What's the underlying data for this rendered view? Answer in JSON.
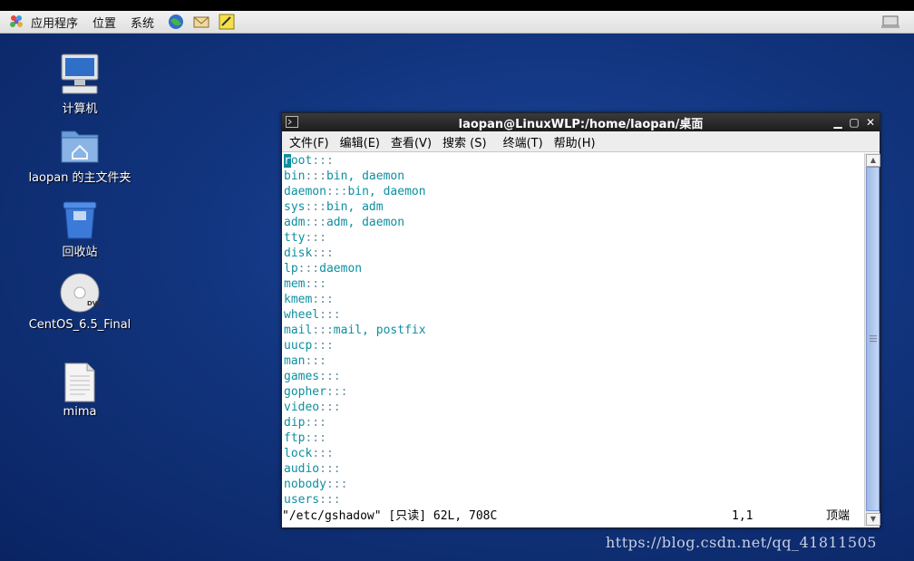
{
  "panel": {
    "menu": [
      "应用程序",
      "位置",
      "系统"
    ]
  },
  "desktop": {
    "icons": [
      {
        "label": "计算机"
      },
      {
        "label": "laopan 的主文件夹"
      },
      {
        "label": "回收站"
      },
      {
        "label": "CentOS_6.5_Final"
      },
      {
        "label": "mima"
      }
    ],
    "dvd_text": "DVD"
  },
  "terminal": {
    "title": "laopan@LinuxWLP:/home/laopan/桌面",
    "menu": [
      "文件(F)",
      "编辑(E)",
      "查看(V)",
      "搜索 (S)",
      "终端(T)",
      "帮助(H)"
    ],
    "lines": [
      {
        "group": "root",
        "members": ""
      },
      {
        "group": "bin",
        "members": "bin, daemon"
      },
      {
        "group": "daemon",
        "members": "bin, daemon"
      },
      {
        "group": "sys",
        "members": "bin, adm"
      },
      {
        "group": "adm",
        "members": "adm, daemon"
      },
      {
        "group": "tty",
        "members": ""
      },
      {
        "group": "disk",
        "members": ""
      },
      {
        "group": "lp",
        "members": "daemon"
      },
      {
        "group": "mem",
        "members": ""
      },
      {
        "group": "kmem",
        "members": ""
      },
      {
        "group": "wheel",
        "members": ""
      },
      {
        "group": "mail",
        "members": "mail, postfix"
      },
      {
        "group": "uucp",
        "members": ""
      },
      {
        "group": "man",
        "members": ""
      },
      {
        "group": "games",
        "members": ""
      },
      {
        "group": "gopher",
        "members": ""
      },
      {
        "group": "video",
        "members": ""
      },
      {
        "group": "dip",
        "members": ""
      },
      {
        "group": "ftp",
        "members": ""
      },
      {
        "group": "lock",
        "members": ""
      },
      {
        "group": "audio",
        "members": ""
      },
      {
        "group": "nobody",
        "members": ""
      },
      {
        "group": "users",
        "members": ""
      }
    ],
    "separator": ":::",
    "status_file": "\"/etc/gshadow\" [只读] 62L, 708C",
    "status_pos": "1,1",
    "status_pct": "顶端"
  },
  "watermark": "https://blog.csdn.net/qq_41811505"
}
